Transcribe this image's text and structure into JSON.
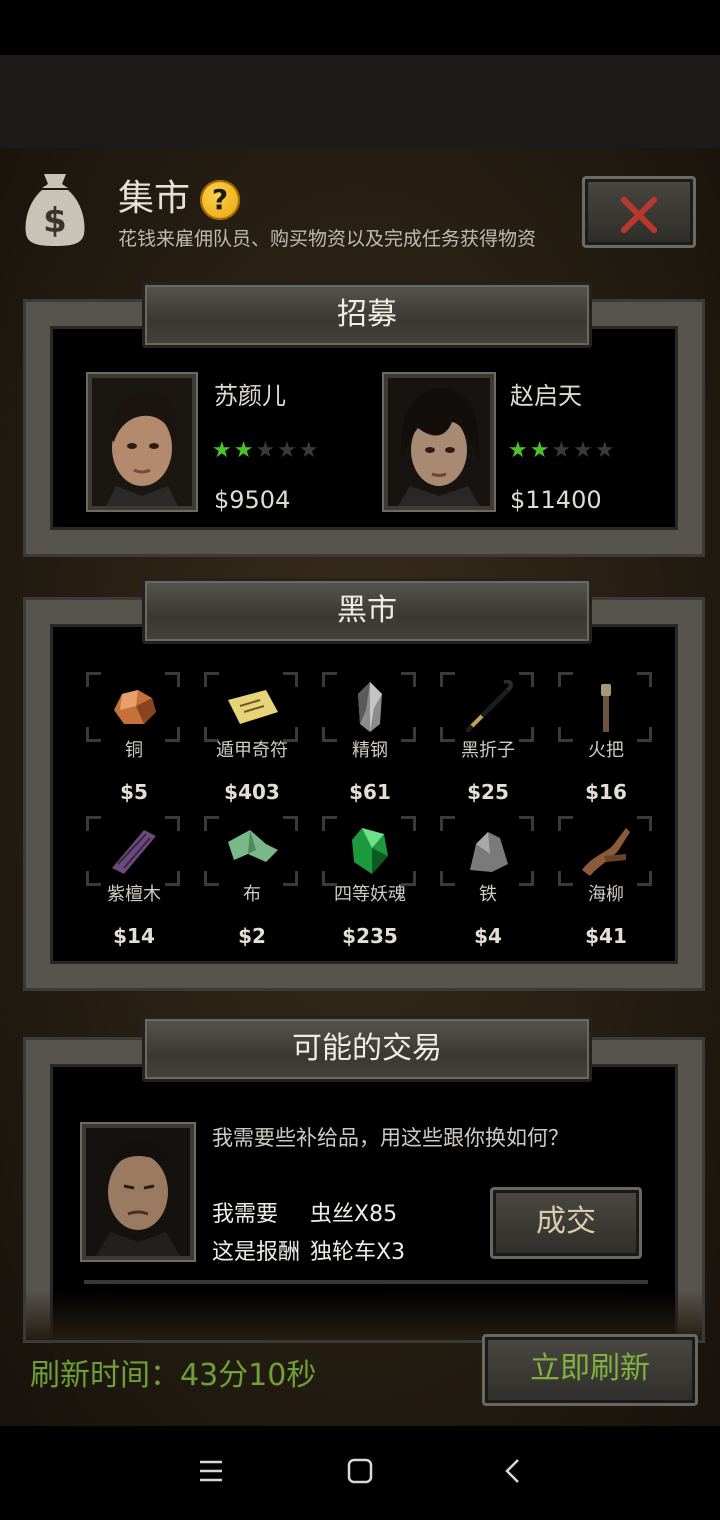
{
  "header": {
    "title": "集市",
    "subtitle": "花钱来雇佣队员、购买物资以及完成任务获得物资",
    "help_icon": "question-icon",
    "bag_icon": "money-bag-icon",
    "close_icon": "close-icon"
  },
  "recruit": {
    "title": "招募",
    "candidates": [
      {
        "name": "苏颜儿",
        "stars": 2,
        "max_stars": 5,
        "price": "$9504"
      },
      {
        "name": "赵启天",
        "stars": 2,
        "max_stars": 5,
        "price": "$11400"
      }
    ]
  },
  "black_market": {
    "title": "黑市",
    "items": [
      {
        "name": "铜",
        "price": "$5",
        "icon": "copper-ore-icon"
      },
      {
        "name": "遁甲奇符",
        "price": "$403",
        "icon": "talisman-icon"
      },
      {
        "name": "精钢",
        "price": "$61",
        "icon": "steel-icon"
      },
      {
        "name": "黑折子",
        "price": "$25",
        "icon": "crowbar-icon"
      },
      {
        "name": "火把",
        "price": "$16",
        "icon": "torch-icon"
      },
      {
        "name": "紫檀木",
        "price": "$14",
        "icon": "rosewood-icon"
      },
      {
        "name": "布",
        "price": "$2",
        "icon": "cloth-icon"
      },
      {
        "name": "四等妖魂",
        "price": "$235",
        "icon": "soul-crystal-icon"
      },
      {
        "name": "铁",
        "price": "$4",
        "icon": "iron-ore-icon"
      },
      {
        "name": "海柳",
        "price": "$41",
        "icon": "driftwood-icon"
      }
    ]
  },
  "trade": {
    "title": "可能的交易",
    "message": "我需要些补给品，用这些跟你换如何？",
    "need_label": "我需要",
    "need_value": "虫丝X85",
    "reward_label": "这是报酬",
    "reward_value": "独轮车X3",
    "deal_label": "成交"
  },
  "footer": {
    "refresh_time": "刷新时间：43分10秒",
    "refresh_now": "立即刷新"
  },
  "colors": {
    "accent_green": "#6fa038",
    "star_green": "#4cc22c",
    "help_yellow": "#f0b21a",
    "close_red": "#b8392b"
  }
}
